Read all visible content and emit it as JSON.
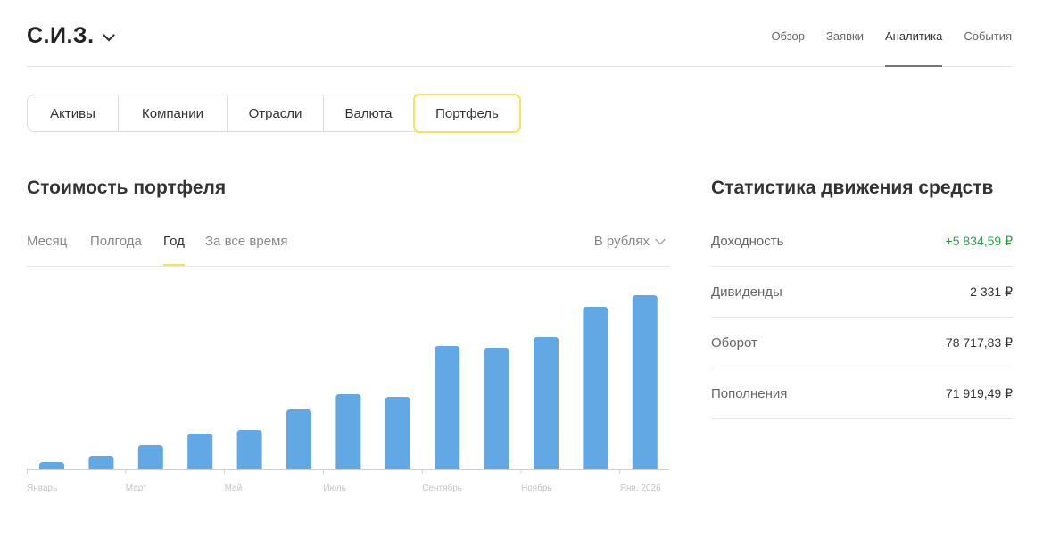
{
  "header": {
    "title": "С.И.З.",
    "nav": [
      {
        "label": "Обзор",
        "active": false
      },
      {
        "label": "Заявки",
        "active": false
      },
      {
        "label": "Аналитика",
        "active": true
      },
      {
        "label": "События",
        "active": false
      }
    ]
  },
  "segments": [
    {
      "label": "Активы",
      "active": false
    },
    {
      "label": "Компании",
      "active": false
    },
    {
      "label": "Отрасли",
      "active": false
    },
    {
      "label": "Валюта",
      "active": false
    },
    {
      "label": "Портфель",
      "active": true
    }
  ],
  "portfolio": {
    "title": "Стоимость портфеля",
    "periods": [
      {
        "label": "Месяц",
        "active": false
      },
      {
        "label": "Полгода",
        "active": false
      },
      {
        "label": "Год",
        "active": true
      },
      {
        "label": "За все время",
        "active": false
      }
    ],
    "currency_label": "В рублях"
  },
  "chart_data": {
    "type": "bar",
    "tick_labels": [
      "Январь",
      "Март",
      "Май",
      "Июль",
      "Сентябрь",
      "Ноябрь",
      "Янв. 2026"
    ],
    "values": [
      8,
      15,
      27,
      40,
      44,
      67,
      84,
      81,
      138,
      136,
      148,
      182,
      195
    ],
    "ylim": [
      0,
      210
    ],
    "grid": false,
    "bar_color": "#62a8e4"
  },
  "stats": {
    "title": "Статистика движения средств",
    "rows": [
      {
        "label": "Доходность",
        "value": "+5 834,59 ₽",
        "positive": true
      },
      {
        "label": "Дивиденды",
        "value": "2 331 ₽",
        "positive": false
      },
      {
        "label": "Оборот",
        "value": "78 717,83 ₽",
        "positive": false
      },
      {
        "label": "Пополнения",
        "value": "71 919,49 ₽",
        "positive": false
      }
    ]
  },
  "colors": {
    "accent": "#f5e35c",
    "positive": "#2e9d4b",
    "bar": "#62a8e4"
  }
}
